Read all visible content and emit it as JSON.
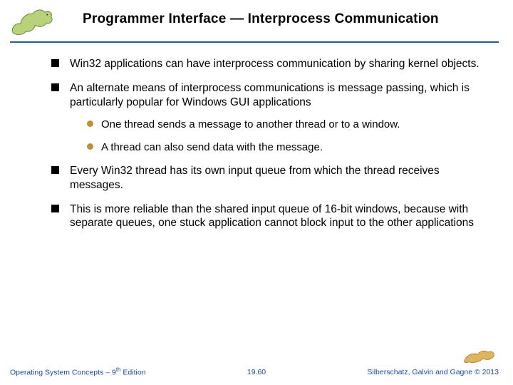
{
  "title": "Programmer Interface —  Interprocess Communication",
  "bullets": [
    {
      "text": "Win32 applications can have interprocess communication by sharing kernel objects."
    },
    {
      "text": "An alternate means of interprocess communications is message passing, which is particularly popular for Windows GUI applications",
      "sub": [
        "One thread sends a message to another thread or to a window.",
        "A thread can also send data with the message."
      ]
    },
    {
      "text": "Every Win32 thread has its own input  queue from which the thread receives messages."
    },
    {
      "text": "This is more reliable than the shared input queue of 16-bit windows, because with separate queues, one stuck application cannot block input to the other applications"
    }
  ],
  "footer": {
    "left_prefix": "Operating System Concepts – 9",
    "left_sup": "th",
    "left_suffix": " Edition",
    "center": "19.60",
    "right": "Silberschatz, Galvin and Gagne © 2013"
  }
}
